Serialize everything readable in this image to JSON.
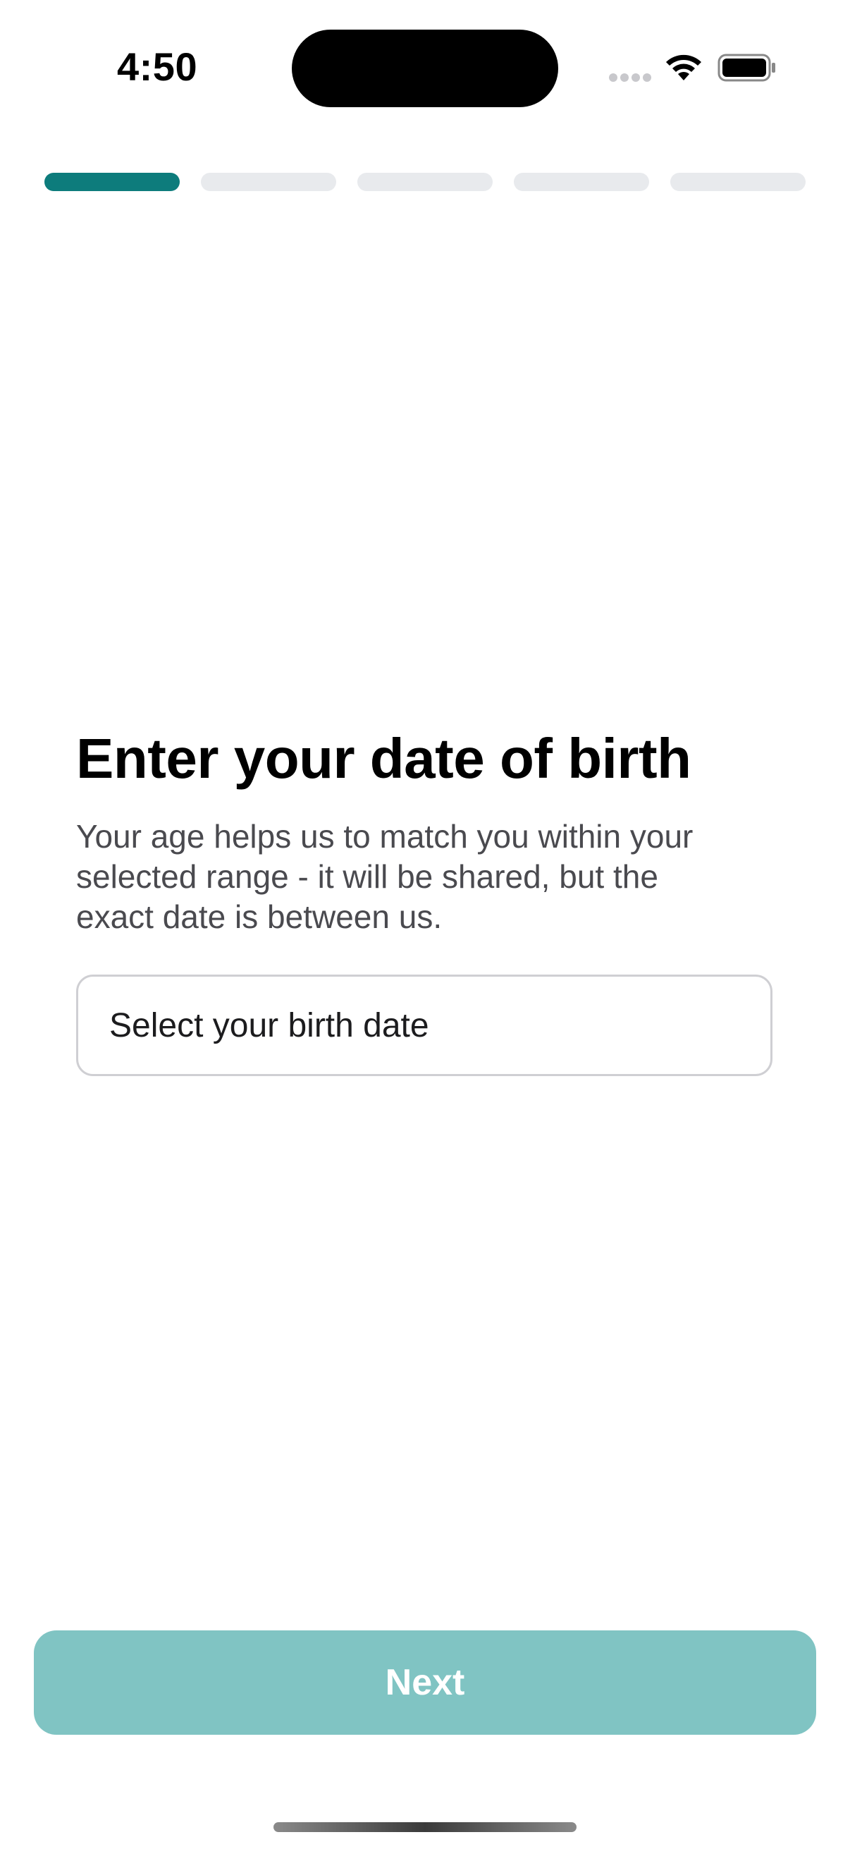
{
  "status_bar": {
    "time": "4:50",
    "icons": [
      "signal-dots-icon",
      "wifi-icon",
      "battery-icon"
    ]
  },
  "progress": {
    "total_steps": 5,
    "current_step": 1,
    "active_color": "#0d7c7c",
    "inactive_color": "#e8eaed"
  },
  "main": {
    "title": "Enter your date of birth",
    "subtitle_lines": [
      "Your age helps us to match you within your",
      "selected range - it will be shared, but the",
      "exact date is between us."
    ],
    "date_field": {
      "placeholder": "Select your birth date"
    }
  },
  "footer": {
    "next_label": "Next",
    "next_color": "#80c4c3"
  }
}
